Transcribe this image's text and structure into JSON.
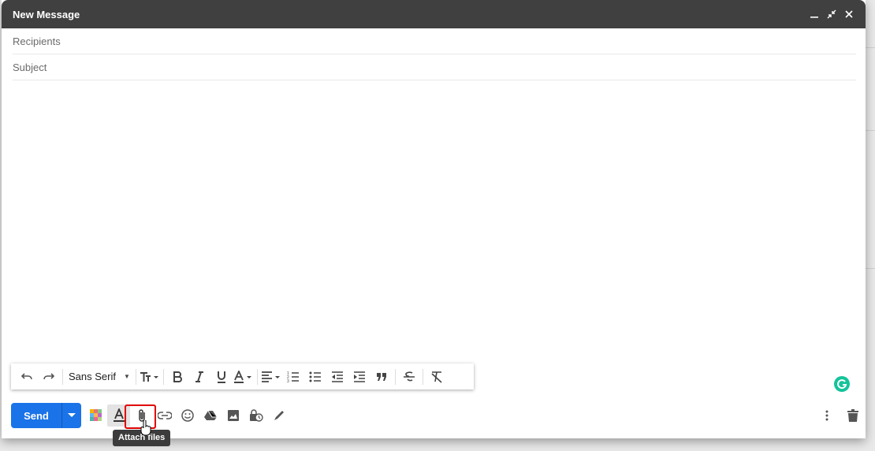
{
  "window": {
    "title": "New Message"
  },
  "fields": {
    "recipients_placeholder": "Recipients",
    "subject_placeholder": "Subject"
  },
  "format": {
    "font_family": "Sans Serif"
  },
  "actions": {
    "send_label": "Send"
  },
  "tooltip": {
    "attach_text": "Attach files"
  },
  "colors": {
    "send": "#1a73e8",
    "titlebar": "#404040",
    "highlight": "#e00000",
    "grammarly": "#15c39a"
  },
  "icons": {
    "title_controls": [
      "minimize-icon",
      "exit-fullscreen-icon",
      "close-icon"
    ],
    "format_bar": [
      "undo-icon",
      "redo-icon",
      "font-size-icon",
      "bold-icon",
      "italic-icon",
      "underline-icon",
      "text-color-icon",
      "align-icon",
      "numbered-list-icon",
      "bulleted-list-icon",
      "indent-less-icon",
      "indent-more-icon",
      "quote-icon",
      "strikethrough-icon",
      "remove-formatting-icon"
    ],
    "bottom_toolbar": [
      "layouts-icon",
      "formatting-options-icon",
      "attach-icon",
      "link-icon",
      "emoji-icon",
      "drive-icon",
      "photo-icon",
      "confidential-mode-icon",
      "signature-icon",
      "more-options-icon",
      "discard-icon"
    ]
  }
}
